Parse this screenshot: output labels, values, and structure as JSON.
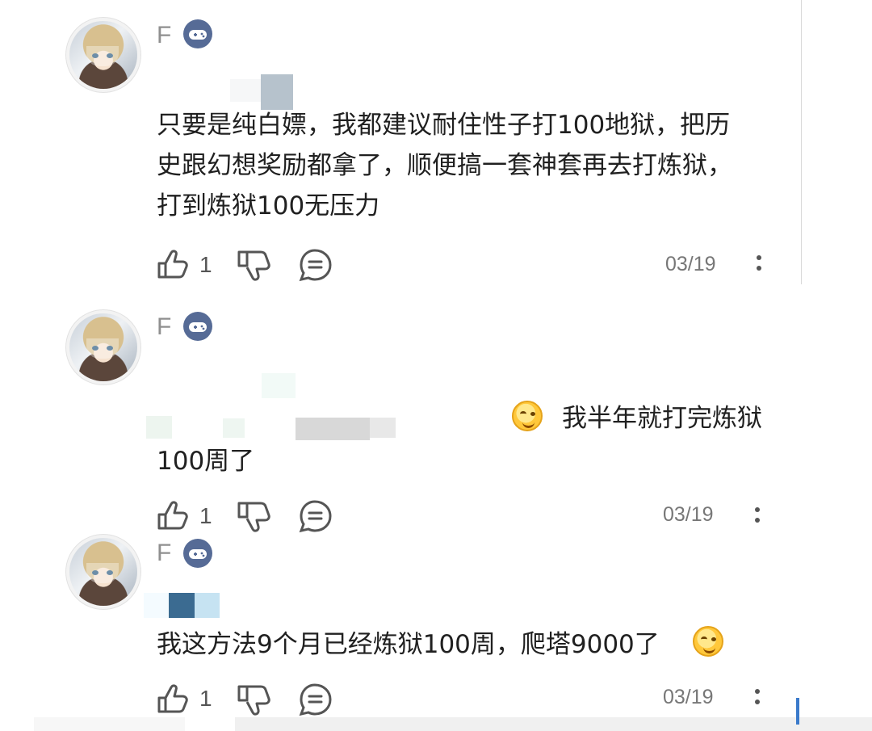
{
  "comments": [
    {
      "username": "F",
      "text": "只要是纯白嫖，我都建议耐住性子打100地狱，把历\n史跟幻想奖励都拿了，顺便搞一套神套再去打炼狱，\n打到炼狱100无压力",
      "like_count": "1",
      "date": "03/19"
    },
    {
      "username": "F",
      "text_line1": "我半年就打完炼狱",
      "text_line2": "100周了",
      "like_count": "1",
      "date": "03/19"
    },
    {
      "username": "F",
      "text": "我这方法9个月已经炼狱100周，爬塔9000了",
      "like_count": "1",
      "date": "03/19"
    }
  ],
  "icons": {
    "game_badge": "game-controller-icon",
    "like": "thumb-up-icon",
    "dislike": "thumb-down-icon",
    "reply": "comment-bubble-icon",
    "more": "more-vertical-icon",
    "emoji": "smirk-emoji-icon"
  },
  "colors": {
    "username": "#8f8f8f",
    "text": "#202020",
    "badge": "#566b96",
    "meta": "#777777"
  }
}
